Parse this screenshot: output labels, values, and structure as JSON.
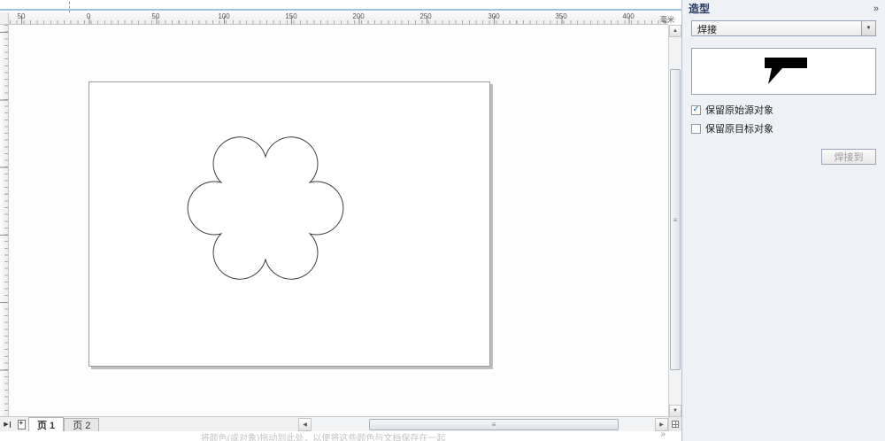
{
  "ruler": {
    "unit_label": "毫米",
    "labels": [
      "50",
      "0",
      "50",
      "100",
      "150",
      "200",
      "250",
      "300",
      "350",
      "400"
    ]
  },
  "docker": {
    "title": "造型",
    "mode_dropdown": {
      "value": "焊接"
    },
    "options": [
      {
        "label": "保留原始源对象",
        "checked": true,
        "check": "✓"
      },
      {
        "label": "保留原目标对象",
        "checked": false,
        "check": ""
      }
    ],
    "action_button": "焊接到"
  },
  "pages": {
    "tabs": [
      {
        "label": "页 1"
      },
      {
        "label": "页 2"
      }
    ]
  },
  "statusbar": {
    "hint": "将颜色(或对象)拖动到此处，以便将这些颜色与文档保存在一起"
  },
  "icons": {
    "collapse": "»",
    "dropdown_arrow": "▼",
    "scroll_up": "▲",
    "scroll_down": "▼",
    "scroll_left": "◀",
    "scroll_right": "▶",
    "grip": "≡",
    "last_page": "▶",
    "add_page": "+",
    "status_expand": "»"
  }
}
